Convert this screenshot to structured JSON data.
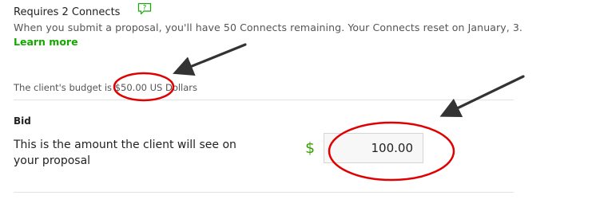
{
  "connects": {
    "title": "Requires 2 Connects",
    "help_icon": "speech-bubble-question-icon",
    "note": "When you submit a proposal, you'll have 50 Connects remaining. Your Connects reset on January, 3.",
    "learn_more": "Learn more"
  },
  "budget": {
    "text": "The client's budget is $50.00 US Dollars"
  },
  "bid": {
    "title": "Bid",
    "description": "This is the amount the client will see on your proposal",
    "currency_symbol": "$",
    "value": "100.00"
  },
  "annotations": {
    "color": "#e00000",
    "arrow_color": "#333333"
  }
}
